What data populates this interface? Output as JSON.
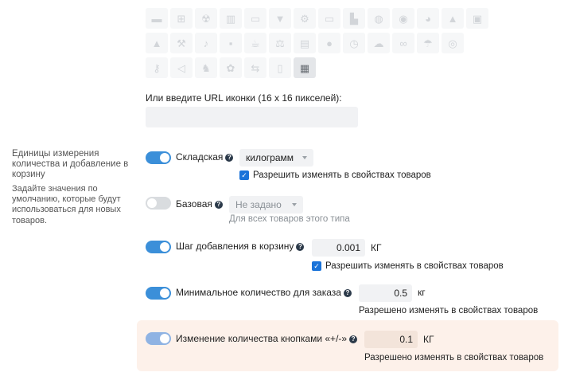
{
  "icon_grid": {
    "rows": [
      [
        "pin-icon",
        "gift-icon",
        "radiation-icon",
        "book-icon",
        "monitor-icon",
        "shirt-icon",
        "gear-icon",
        "laptop-icon",
        "factory-icon",
        "bag-icon",
        "chat-icon",
        "palette-icon",
        "monument-icon",
        "image-icon"
      ],
      [
        "warning-icon",
        "hammer-icon",
        "guitar-icon",
        "floppy-icon",
        "coffee-icon",
        "gavel-icon",
        "archive-icon",
        "bulb-icon",
        "clock-icon",
        "cloud-download-icon",
        "glasses-icon",
        "umbrella-icon",
        "gamepad-icon"
      ],
      [
        "key-icon",
        "fish-icon",
        "cat-icon",
        "paw-icon",
        "usb-icon",
        "spray-icon",
        "box-icon"
      ]
    ],
    "glyphs": {
      "pin-icon": "▬",
      "gift-icon": "⊞",
      "radiation-icon": "☢",
      "book-icon": "▥",
      "monitor-icon": "▭",
      "shirt-icon": "▼",
      "gear-icon": "⚙",
      "laptop-icon": "▭",
      "factory-icon": "▙",
      "bag-icon": "◍",
      "chat-icon": "◉",
      "palette-icon": "◕",
      "monument-icon": "▲",
      "image-icon": "▣",
      "warning-icon": "▲",
      "hammer-icon": "⚒",
      "guitar-icon": "♪",
      "floppy-icon": "▪",
      "coffee-icon": "☕",
      "gavel-icon": "⚖",
      "archive-icon": "▤",
      "bulb-icon": "●",
      "clock-icon": "◷",
      "cloud-download-icon": "☁",
      "glasses-icon": "∞",
      "umbrella-icon": "☂",
      "gamepad-icon": "◎",
      "key-icon": "⚷",
      "fish-icon": "◁",
      "cat-icon": "♞",
      "paw-icon": "✿",
      "usb-icon": "⇆",
      "spray-icon": "▯",
      "box-icon": "▦"
    },
    "selected": "box-icon"
  },
  "url_label": "Или введите URL иконки (16 x 16 пикселей):",
  "url_value": "",
  "side": {
    "title": "Единицы измерения количества и добавление в корзину",
    "desc": "Задайте значения по умолчанию, которые будут использоваться для новых товаров."
  },
  "help_glyph": "?",
  "check_glyph": "✓",
  "stock": {
    "label": "Складская",
    "unit_select": "килограмм",
    "allow_text": "Разрешить изменять в свойствах товаров"
  },
  "base": {
    "label": "Базовая",
    "select": "Не задано",
    "hint": "Для всех товаров этого типа"
  },
  "step": {
    "label": "Шаг добавления в корзину",
    "value": "0.001",
    "unit": "КГ",
    "allow_text": "Разрешить изменять в свойствах товаров"
  },
  "min_qty": {
    "label": "Минимальное количество для заказа",
    "value": "0.5",
    "unit": "кг",
    "note": "Разрешено изменять в свойствах товаров"
  },
  "plusminus": {
    "label": "Изменение количества кнопками «+/-»",
    "value": "0.1",
    "unit": "КГ",
    "note": "Разрешено изменять в свойствах товаров"
  },
  "colors": {
    "toggle_on": "#3b8fd9",
    "toggle_off": "#d9dcdf",
    "checkbox": "#1a73d9",
    "highlight": "#fdf1ea"
  }
}
